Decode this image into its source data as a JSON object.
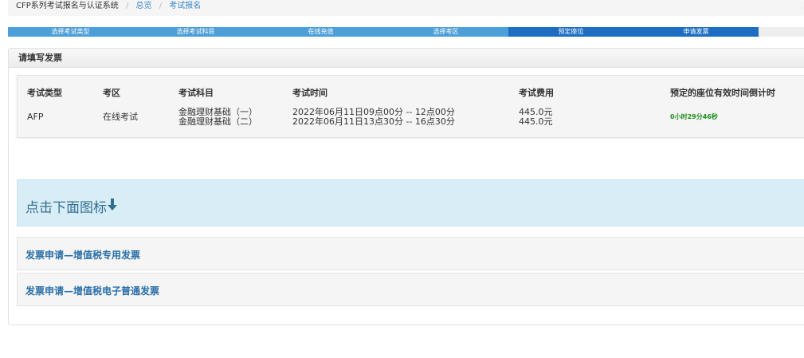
{
  "breadcrumb": {
    "system": "CFP系列考试报名与认证系统",
    "separator": "/",
    "overview": "总览",
    "current": "考试报名"
  },
  "steps": [
    {
      "label": "选择考试类型",
      "state": "done"
    },
    {
      "label": "选择考试科目",
      "state": "done"
    },
    {
      "label": "在线充值",
      "state": "done"
    },
    {
      "label": "选择考区",
      "state": "done"
    },
    {
      "label": "预定座位",
      "state": "active"
    },
    {
      "label": "申请发票",
      "state": "active"
    }
  ],
  "panel": {
    "title": "请填写发票"
  },
  "table": {
    "headers": {
      "exam_type": "考试类型",
      "region": "考区",
      "subject": "考试科目",
      "time": "考试时间",
      "fee": "考试费用",
      "countdown": "预定的座位有效时间倒计时"
    },
    "row": {
      "exam_type": "AFP",
      "region": "在线考试",
      "subjects": [
        "金融理财基础（一）",
        "金融理财基础（二）"
      ],
      "times": [
        "2022年06月11日09点00分 -- 12点00分",
        "2022年06月11日13点30分 -- 16点30分"
      ],
      "fees": [
        "445.0元",
        "445.0元"
      ],
      "countdown": "0小时29分46秒"
    }
  },
  "alert": {
    "text": "点击下面图标"
  },
  "invoices": {
    "special": "发票申请—增值税专用发票",
    "electronic": "发票申请—增值税电子普通发票"
  },
  "colors": {
    "step_done": "#4c9fd8",
    "step_active": "#1d6ec2",
    "countdown": "#1e8e1e",
    "link": "#2a6fa9",
    "alert_bg": "#d9edf7"
  },
  "icons": {
    "alert_arrow": "arrow-down-icon"
  }
}
